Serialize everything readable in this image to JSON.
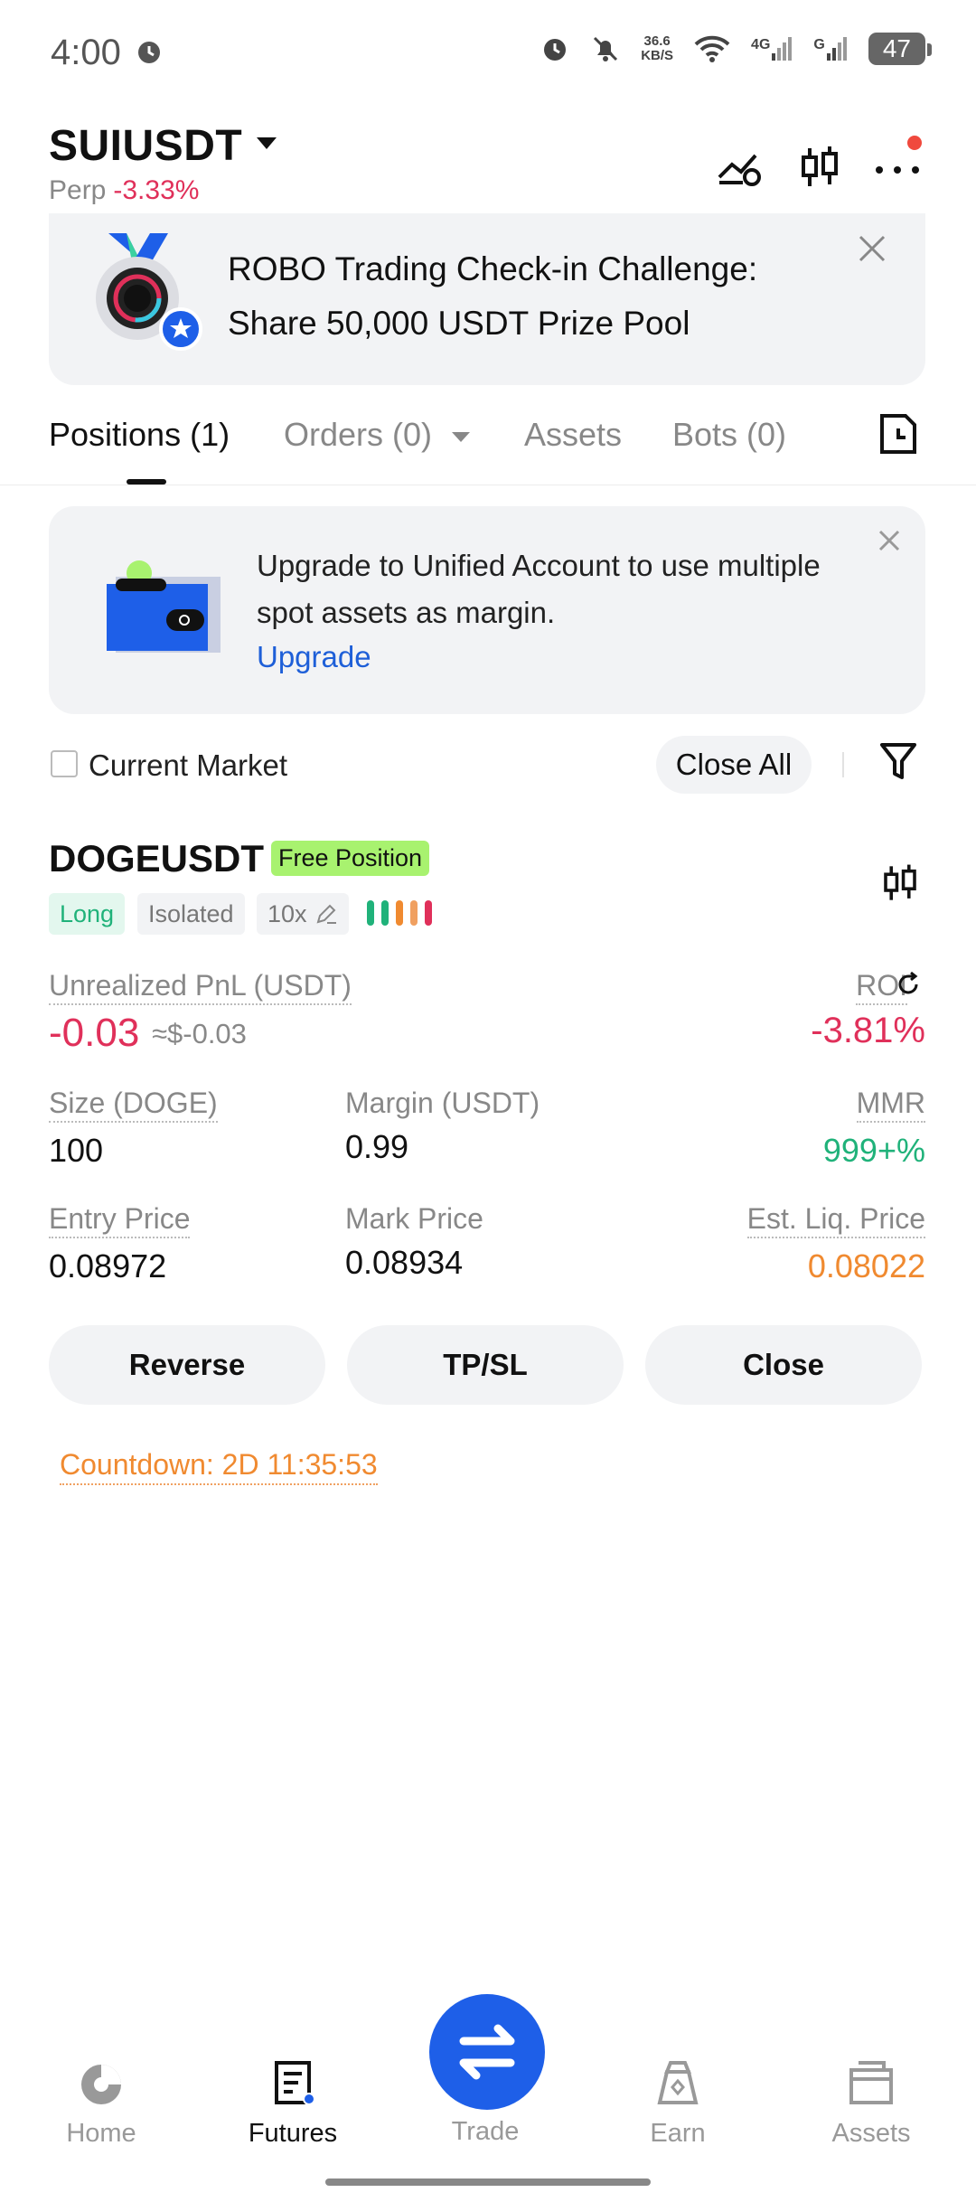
{
  "status_bar": {
    "time": "4:00",
    "net_speed_value": "36.6",
    "net_speed_unit": "KB/S",
    "net1": "4G",
    "net2": "G",
    "battery": "47"
  },
  "header": {
    "pair": "SUIUSDT",
    "type": "Perp",
    "change": "-3.33%"
  },
  "promo": {
    "text": "ROBO Trading Check-in Challenge: Share 50,000 USDT Prize Pool"
  },
  "tabs": [
    {
      "label": "Positions (1)"
    },
    {
      "label": "Orders (0)"
    },
    {
      "label": "Assets"
    },
    {
      "label": "Bots (0)"
    }
  ],
  "upgrade_card": {
    "text": "Upgrade to Unified Account to use multiple spot assets as margin.",
    "link": "Upgrade"
  },
  "filter": {
    "current_market": "Current Market",
    "close_all": "Close All"
  },
  "position": {
    "symbol": "DOGEUSDT",
    "badge": "Free Position",
    "tags": {
      "side": "Long",
      "mode": "Isolated",
      "leverage": "10x"
    },
    "upnl_label": "Unrealized PnL (USDT)",
    "upnl_value": "-0.03",
    "upnl_usd": "≈$-0.03",
    "roi_label": "ROI",
    "roi_value": "-3.81%",
    "size_label": "Size (DOGE)",
    "size_value": "100",
    "margin_label": "Margin (USDT)",
    "margin_value": "0.99",
    "mmr_label": "MMR",
    "mmr_value": "999+%",
    "entry_label": "Entry Price",
    "entry_value": "0.08972",
    "mark_label": "Mark Price",
    "mark_value": "0.08934",
    "liq_label": "Est. Liq. Price",
    "liq_value": "0.08022",
    "buttons": {
      "reverse": "Reverse",
      "tpsl": "TP/SL",
      "close": "Close"
    },
    "countdown": "Countdown:  2D 11:35:53"
  },
  "nav": {
    "home": "Home",
    "futures": "Futures",
    "trade": "Trade",
    "earn": "Earn",
    "assets": "Assets"
  },
  "colors": {
    "negative": "#e0305a",
    "positive": "#20b27a",
    "warning": "#f08a30",
    "brand": "#1e5fe8",
    "badge_green": "#a8f26f"
  }
}
